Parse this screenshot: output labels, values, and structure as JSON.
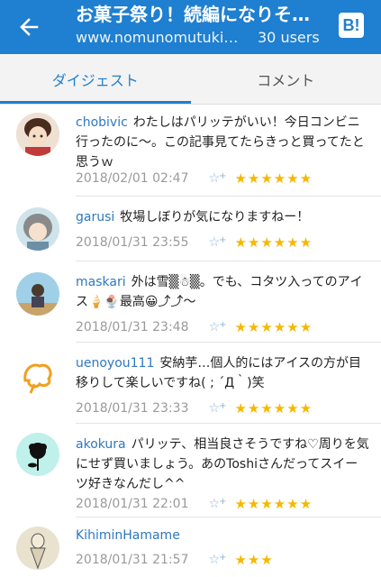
{
  "header": {
    "title": "お菓子祭り！続編になりそうだ",
    "url": "www.nomunomutuki.com",
    "users": "30 users",
    "hatena_label": "B!"
  },
  "tabs": [
    {
      "label": "ダイジェスト",
      "active": true
    },
    {
      "label": "コメント",
      "active": false
    }
  ],
  "comments": [
    {
      "user": "chobivic",
      "text": "わたしはパリッテがいい！今日コンビニ行ったのに〜。この記事見てたらきっと買ってたと思うｗ",
      "date": "2018/02/01 02:47",
      "stars": "★★★★★★"
    },
    {
      "user": "garusi",
      "text": "牧場しぼりが気になりますねー！",
      "date": "2018/01/31 23:55",
      "stars": "★★★★★★"
    },
    {
      "user": "maskari",
      "text": "外は雪▒☃▒。でも、コタツ入ってのアイス🍦🍨最高😀⤴⤴〜",
      "date": "2018/01/31 23:48",
      "stars": "★★★★★★"
    },
    {
      "user": "uenoyou111",
      "text": "安納芋…個人的にはアイスの方が目移りして楽しいですね( ; ´Д｀)笑",
      "date": "2018/01/31 23:33",
      "stars": "★★★★★★"
    },
    {
      "user": "akokura",
      "text": "パリッテ、相当良さそうですね♡周りを気にせず買いましょう。あのToshiさんだってスイーツ好きなんだし^^",
      "date": "2018/01/31 22:01",
      "stars": "★★★★★★"
    },
    {
      "user": "KihiminHamame",
      "text": "",
      "date": "2018/01/31 21:57",
      "stars": "★★★"
    }
  ],
  "colors": {
    "accent": "#1f7fd0",
    "star": "#f5b800",
    "username": "#2e78c0"
  }
}
